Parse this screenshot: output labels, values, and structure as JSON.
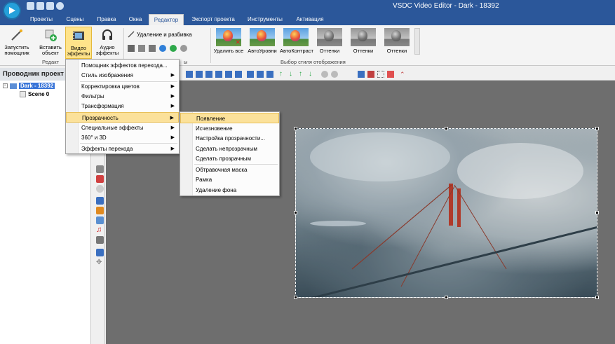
{
  "window": {
    "title": "VSDC Video Editor - Dark - 18392"
  },
  "tabs": [
    {
      "label": "Проекты"
    },
    {
      "label": "Сцены"
    },
    {
      "label": "Правка"
    },
    {
      "label": "Окна"
    },
    {
      "label": "Редактор"
    },
    {
      "label": "Экспорт проекта"
    },
    {
      "label": "Инструменты"
    },
    {
      "label": "Активация"
    }
  ],
  "ribbon": {
    "launch": {
      "line1": "Запустить",
      "line2": "помощник"
    },
    "insert": {
      "line1": "Вставить",
      "line2": "объект"
    },
    "video": {
      "line1": "Видео",
      "line2": "эффекты"
    },
    "audio": {
      "line1": "Аудио",
      "line2": "эффекты"
    },
    "delete_split": "Удаление и разбивка",
    "group_editor": "Редакт",
    "group_tools": "ы",
    "group_style": "Выбор стиля отображения",
    "styles": [
      {
        "label": "Удалить все"
      },
      {
        "label": "АвтоУровни"
      },
      {
        "label": "АвтоКонтраст"
      },
      {
        "label": "Оттенки"
      },
      {
        "label": "Оттенки"
      },
      {
        "label": "Оттенки"
      }
    ]
  },
  "left_panel": {
    "title": "Проводник проект",
    "tree": {
      "project": "Dark - 18392",
      "scene": "Scene 0"
    }
  },
  "main_menu": {
    "items": [
      {
        "label": "Помощник эффектов перехода...",
        "submenu": false
      },
      {
        "label": "Стиль изображения",
        "submenu": true
      },
      {
        "label": "Корректировка цветов",
        "submenu": true
      },
      {
        "label": "Фильтры",
        "submenu": true
      },
      {
        "label": "Трансформация",
        "submenu": true
      },
      {
        "label": "Прозрачность",
        "submenu": true
      },
      {
        "label": "Специальные эффекты",
        "submenu": true
      },
      {
        "label": "360° и 3D",
        "submenu": true
      },
      {
        "label": "Эффекты перехода",
        "submenu": true
      }
    ]
  },
  "sub_menu": {
    "items": [
      {
        "label": "Появление"
      },
      {
        "label": "Исчезновение"
      },
      {
        "label": "Настройка прозрачности..."
      },
      {
        "label": "Сделать непрозрачным"
      },
      {
        "label": "Сделать прозрачным"
      },
      {
        "label": "Обтравочная маска"
      },
      {
        "label": "Рамка"
      },
      {
        "label": "Удаление фона"
      }
    ]
  },
  "colors": {
    "accent": "#2b579a",
    "highlight": "#fbe19a",
    "canvas": "#6e6e6e"
  }
}
